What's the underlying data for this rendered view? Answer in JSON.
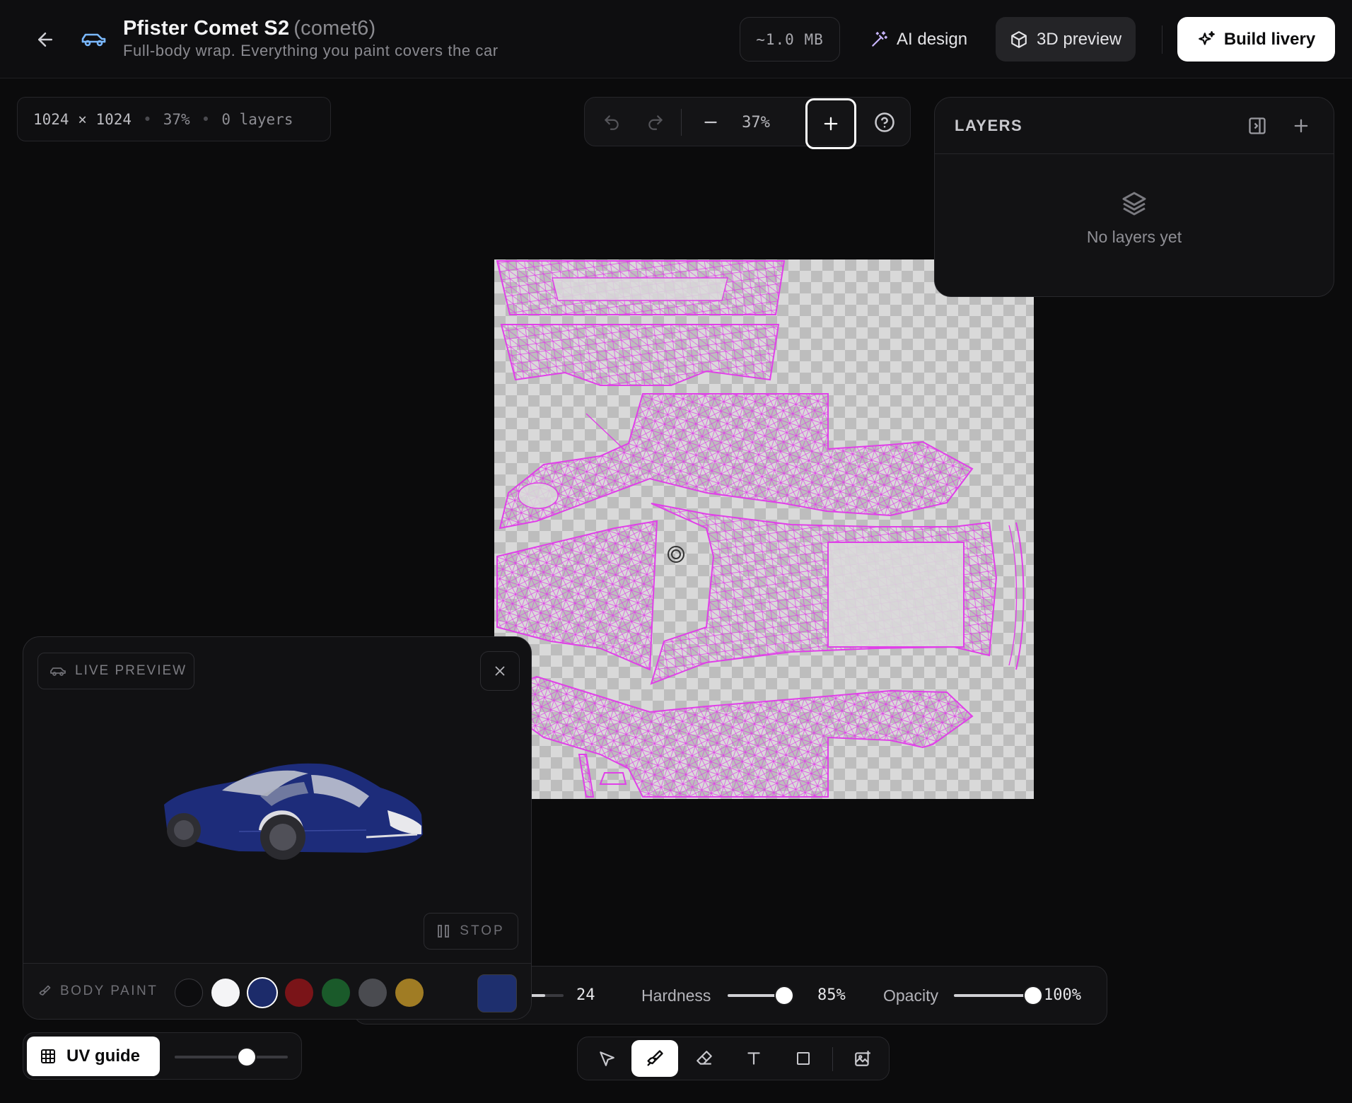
{
  "header": {
    "title": "Pfister Comet S2",
    "code": "(comet6)",
    "subtitle": "Full-body wrap. Everything you paint covers the car",
    "file_size": "~1.0 MB",
    "ai_design_label": "AI design",
    "preview_label": "3D preview",
    "build_label": "Build livery",
    "accent_color": "#7ab8ff"
  },
  "info": {
    "resolution": "1024 × 1024",
    "zoom": "37%",
    "layers": "0 layers"
  },
  "zoom_bar": {
    "zoom": "37%"
  },
  "layers_panel": {
    "title": "LAYERS",
    "empty_text": "No layers yet"
  },
  "brush": {
    "size_value": "24",
    "hardness_label": "Hardness",
    "hardness_value": "85%",
    "hardness": 0.85,
    "opacity_label": "Opacity",
    "opacity_value": "100%",
    "opacity": 1.0
  },
  "tools": {
    "items": [
      "select",
      "brush",
      "eraser",
      "text",
      "rectangle",
      "image"
    ],
    "active": "brush"
  },
  "live_preview": {
    "badge": "LIVE PREVIEW",
    "stop_label": "STOP",
    "body_paint_label": "BODY PAINT",
    "swatches": [
      "#0d0d0f",
      "#f4f4f6",
      "#1c2b6a",
      "#7a1418",
      "#1a5a2a",
      "#4a4b50",
      "#a07c24"
    ],
    "selected_swatch": "#1c2b6a",
    "custom_color": "#1e2f6e",
    "car_color": "#1d2c7a"
  },
  "uv_guide": {
    "label": "UV guide",
    "opacity": 0.64
  },
  "uv_color": "#e040e8"
}
